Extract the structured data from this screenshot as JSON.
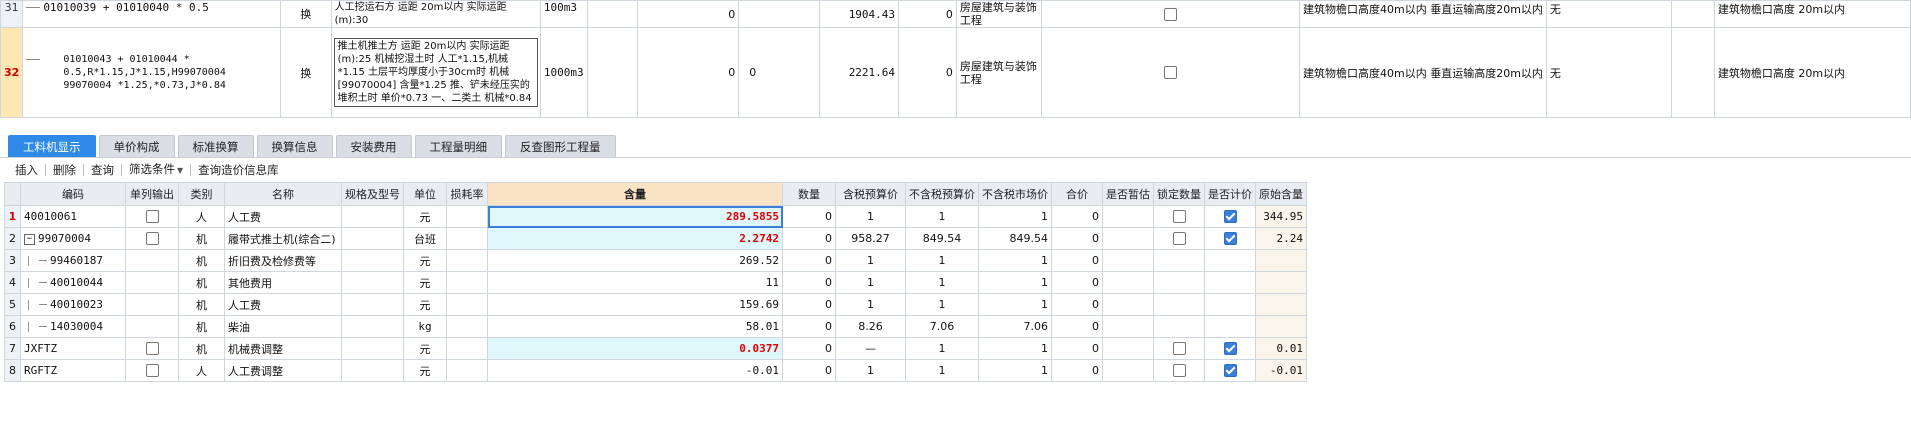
{
  "upper_rows": [
    {
      "row_no": "31",
      "code": "01010039 + 01010040 * 0.5",
      "type": "换",
      "name": "人工挖运石方 运距 20m以内   实际运距(m):30",
      "unit": "100m3",
      "col5": "",
      "col6": "0",
      "col7": "",
      "price": "1904.43",
      "col9": "0",
      "major": "房屋建筑与装饰工程",
      "desc": "建筑物檐口高度40m以内 垂直运输高度20m以内",
      "flag": "无",
      "desc2": "建筑物檐口高度 20m以内"
    },
    {
      "row_no": "32",
      "code": "01010043 + 01010044 * 0.5,R*1.15,J*1.15,H99070004 99070004 *1.25,*0.73,J*0.84",
      "type": "换",
      "name": "推土机推土方 运距 20m以内   实际运距(m):25  机械挖湿土时 人工*1.15,机械*1.15  土层平均厚度小于30cm时 机械[99070004] 含量*1.25  推、铲未经压实的堆积土时 单价*0.73  一、二类土 机械*0.84",
      "unit": "1000m3",
      "col5": "",
      "col6": "0",
      "col7": "0",
      "price": "2221.64",
      "col9": "0",
      "major": "房屋建筑与装饰工程",
      "desc": "建筑物檐口高度40m以内 垂直运输高度20m以内",
      "flag": "无",
      "desc2": "建筑物檐口高度 20m以内"
    }
  ],
  "tabs": [
    "工料机显示",
    "单价构成",
    "标准换算",
    "换算信息",
    "安装费用",
    "工程量明细",
    "反查图形工程量"
  ],
  "toolbar": {
    "insert": "插入",
    "delete": "删除",
    "query": "查询",
    "filter": "筛选条件",
    "price_lib": "查询造价信息库"
  },
  "columns": [
    "编码",
    "单列输出",
    "类别",
    "名称",
    "规格及型号",
    "单位",
    "损耗率",
    "含量",
    "数量",
    "含税预算价",
    "不含税预算价",
    "不含税市场价",
    "合价",
    "是否暂估",
    "锁定数量",
    "是否计价",
    "原始含量"
  ],
  "rows": [
    {
      "idx": "1",
      "code": "40010061",
      "out": true,
      "cat": "人",
      "name": "人工费",
      "spec": "",
      "unit": "元",
      "loss": "",
      "qty": "289.5855",
      "count": "0",
      "tax_price": "1",
      "notax_price": "1",
      "market": "1",
      "total": "0",
      "est": false,
      "lock": true,
      "priced": true,
      "orig": "344.95"
    },
    {
      "idx": "2",
      "code": "99070004",
      "out": true,
      "cat": "机",
      "name": "履带式推土机(综合二)",
      "spec": "",
      "unit": "台班",
      "loss": "",
      "qty": "2.2742",
      "count": "0",
      "tax_price": "958.27",
      "notax_price": "849.54",
      "market": "849.54",
      "total": "0",
      "est": false,
      "lock": true,
      "priced": true,
      "orig": "2.24"
    },
    {
      "idx": "3",
      "code": "99460187",
      "out": false,
      "cat": "机",
      "name": "折旧费及检修费等",
      "spec": "",
      "unit": "元",
      "loss": "",
      "qty": "269.52",
      "count": "0",
      "tax_price": "1",
      "notax_price": "1",
      "market": "1",
      "total": "0",
      "est": false,
      "lock": false,
      "priced": false,
      "orig": ""
    },
    {
      "idx": "4",
      "code": "40010044",
      "out": false,
      "cat": "机",
      "name": "其他费用",
      "spec": "",
      "unit": "元",
      "loss": "",
      "qty": "11",
      "count": "0",
      "tax_price": "1",
      "notax_price": "1",
      "market": "1",
      "total": "0",
      "est": false,
      "lock": false,
      "priced": false,
      "orig": ""
    },
    {
      "idx": "5",
      "code": "40010023",
      "out": false,
      "cat": "机",
      "name": "人工费",
      "spec": "",
      "unit": "元",
      "loss": "",
      "qty": "159.69",
      "count": "0",
      "tax_price": "1",
      "notax_price": "1",
      "market": "1",
      "total": "0",
      "est": false,
      "lock": false,
      "priced": false,
      "orig": ""
    },
    {
      "idx": "6",
      "code": "14030004",
      "out": false,
      "cat": "机",
      "name": "柴油",
      "spec": "",
      "unit": "kg",
      "loss": "",
      "qty": "58.01",
      "count": "0",
      "tax_price": "8.26",
      "notax_price": "7.06",
      "market": "7.06",
      "total": "0",
      "est": false,
      "lock": false,
      "priced": false,
      "orig": ""
    },
    {
      "idx": "7",
      "code": "JXFTZ",
      "out": true,
      "cat": "机",
      "name": "机械费调整",
      "spec": "",
      "unit": "元",
      "loss": "",
      "qty": "0.0377",
      "count": "0",
      "tax_price": "—",
      "notax_price": "1",
      "market": "1",
      "total": "0",
      "est": false,
      "lock": true,
      "priced": true,
      "orig": "0.01"
    },
    {
      "idx": "8",
      "code": "RGFTZ",
      "out": true,
      "cat": "人",
      "name": "人工费调整",
      "spec": "",
      "unit": "元",
      "loss": "",
      "qty": "-0.01",
      "count": "0",
      "tax_price": "1",
      "notax_price": "1",
      "market": "1",
      "total": "0",
      "est": false,
      "lock": true,
      "priced": true,
      "orig": "-0.01"
    }
  ]
}
